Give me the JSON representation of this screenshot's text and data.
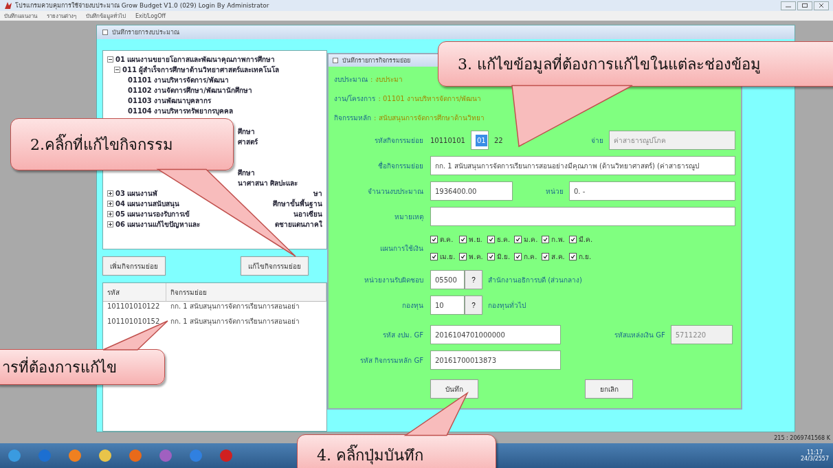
{
  "window": {
    "title": "โปรแกรมควบคุมการใช้จ่ายงบประมาณ Grow Budget V1.0 (029)  Login By Administrator"
  },
  "menu": [
    "บันทึกแผนงาน",
    "รายงานต่างๆ",
    "บันทึกข้อมูลทั่วไป",
    "Exit/LogOff"
  ],
  "inner_window": {
    "title": "บันทึกรายการงบประมาณ"
  },
  "tree": [
    {
      "kind": "node",
      "label": "01 แผนงานขยายโอกาสและพัฒนาคุณภาพการศึกษา",
      "expanded": true,
      "children": [
        {
          "kind": "node",
          "label": "011 ผู้สำเร็จการศึกษาด้านวิทยาศาสตร์และเทคโนโล",
          "expanded": true,
          "children": [
            {
              "kind": "leaf",
              "label": "01101 งานบริหารจัดการ/พัฒนา"
            },
            {
              "kind": "leaf",
              "label": "01102 งานจัดการศึกษา/พัฒนานักศึกษา"
            },
            {
              "kind": "leaf",
              "label": "01103 งานพัฒนาบุคลากร"
            },
            {
              "kind": "leaf",
              "label": "01104 งานบริหารทรัพยากรบุคคล"
            },
            {
              "kind": "gap"
            },
            {
              "kind": "partial",
              "label": "ศึกษา"
            },
            {
              "kind": "partial",
              "label": "ศาสตร์"
            },
            {
              "kind": "gap"
            },
            {
              "kind": "gap"
            },
            {
              "kind": "partial",
              "label": "ศึกษา"
            },
            {
              "kind": "partial",
              "label": "นาศาสนา ศิลปะและ"
            }
          ]
        }
      ]
    },
    {
      "kind": "node",
      "label": "03 แผนงานพั",
      "rest": "ษา",
      "expanded": false
    },
    {
      "kind": "node",
      "label": "04 แผนงานสนับสนุน",
      "rest": "ศึกษาขั้นพื้นฐาน",
      "expanded": false
    },
    {
      "kind": "node",
      "label": "05 แผนงานรองรับการเข้",
      "rest": "นอาเซียน",
      "expanded": false
    },
    {
      "kind": "node",
      "label": "06 แผนงานแก้ไขปัญหาและ",
      "rest": "ดชายแดนภาคใ",
      "expanded": false
    }
  ],
  "left_buttons": [
    "เพิ่มกิจกรรมย่อย",
    "แก้ไขกิจกรรมย่อย"
  ],
  "table": {
    "columns": [
      "รหัส",
      "กิจกรรมย่อย"
    ],
    "rows": [
      [
        "101101010122",
        "กก. 1 สนับสนุนการจัดการเรียนการสอนอย่า"
      ],
      [
        "101101010152",
        "กก. 1 สนับสนุนการจัดการเรียนการสอนอย่า"
      ]
    ]
  },
  "dialog": {
    "title": "บันทึกรายการกิจกรรมย่อย",
    "info": [
      {
        "label": "งบประมาณ",
        "value": ": งบประมา"
      },
      {
        "label": "งาน/โครงการ",
        "value": ": 01101 งานบริหารจัดการ/พัฒนา"
      },
      {
        "label": "กิจกรรมหลัก",
        "value": ": สนับสนุนการจัดการศึกษาด้านวิทยา"
      }
    ],
    "code": {
      "label": "รหัสกิจกรรมย่อย",
      "prefix": "10110101",
      "selected_part": "01",
      "suffix": "22"
    },
    "category": {
      "label": "จ่าย",
      "value": "ค่าสาธารณูปโภค",
      "disabled": true
    },
    "name": {
      "label": "ชื่อกิจกรรมย่อย",
      "value": "กก. 1 สนับสนุนการจัดการเรียนการสอนอย่างมีคุณภาพ (ด้านวิทยาศาสตร์) (ค่าสาธารณูป"
    },
    "amount": {
      "label": "จำนวนงบประมาณ",
      "value": "1936400.00"
    },
    "unit": {
      "label": "หน่วย",
      "value": "0. -"
    },
    "note": {
      "label": "หมายเหตุ"
    },
    "plan": {
      "label": "แผนการใช้เงิน",
      "months": [
        {
          "label": "ต.ค.",
          "checked": true
        },
        {
          "label": "พ.ย.",
          "checked": true
        },
        {
          "label": "ธ.ค.",
          "checked": true
        },
        {
          "label": "ม.ค.",
          "checked": true
        },
        {
          "label": "ก.พ.",
          "checked": true
        },
        {
          "label": "มี.ค.",
          "checked": true
        },
        {
          "label": "เม.ย.",
          "checked": true
        },
        {
          "label": "พ.ค.",
          "checked": true
        },
        {
          "label": "มิ.ย.",
          "checked": true
        },
        {
          "label": "ก.ค.",
          "checked": true
        },
        {
          "label": "ส.ค.",
          "checked": true
        },
        {
          "label": "ก.ย.",
          "checked": true
        }
      ]
    },
    "lookups": [
      {
        "label": "หน่วยงานรับผิดชอบ",
        "value": "05500",
        "button": "?",
        "name": "สำนักงานอธิการบดี (ส่วนกลาง)"
      },
      {
        "label": "กองทุน",
        "value": "10",
        "button": "?",
        "name": "กองทุนทั่วไป"
      }
    ],
    "gf_budget": {
      "label": "รหัส งปม. GF",
      "value": "2016104701000000"
    },
    "gf_source": {
      "label": "รหัสแหล่งเงิน GF",
      "value": "5711220",
      "disabled": true
    },
    "gf_activity": {
      "label": "รหัส กิจกรรมหลัก GF",
      "value": "20161700013873"
    },
    "buttons": [
      "บันทึก",
      "ยกเลิก"
    ]
  },
  "status": "215 : 2069741568 K",
  "clock": {
    "time": "11:17",
    "date": "24/3/2557"
  },
  "callouts": [
    {
      "text": "3. แก้ไขข้อมูลที่ต้องการแก้ไขในแต่ละช่องข้อมู"
    },
    {
      "text": "2.คลิ๊กที่แก้ไขกิจกรรม"
    },
    {
      "text": "ารที่ต้องการแก้ไข"
    },
    {
      "text": "4. คลิ๊กปุ่มบันทึก"
    }
  ]
}
